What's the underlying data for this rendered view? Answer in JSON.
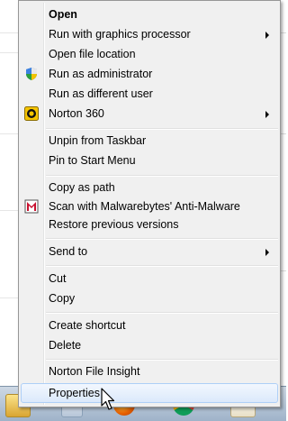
{
  "menu": {
    "items": [
      {
        "label": "Open",
        "bold": true
      },
      {
        "label": "Run with graphics processor",
        "submenu": true
      },
      {
        "label": "Open file location"
      },
      {
        "label": "Run as administrator",
        "icon": "uac-shield-icon"
      },
      {
        "label": "Run as different user"
      },
      {
        "label": "Norton 360",
        "icon": "norton-icon",
        "submenu": true
      },
      {
        "label": "Unpin from Taskbar"
      },
      {
        "label": "Pin to Start Menu"
      },
      {
        "label": "Copy as path"
      },
      {
        "label": "Scan with Malwarebytes' Anti-Malware",
        "icon": "malwarebytes-icon"
      },
      {
        "label": "Restore previous versions"
      },
      {
        "label": "Send to",
        "submenu": true
      },
      {
        "label": "Cut"
      },
      {
        "label": "Copy"
      },
      {
        "label": "Create shortcut"
      },
      {
        "label": "Delete"
      },
      {
        "label": "Norton File Insight"
      },
      {
        "label": "Properties",
        "highlighted": true
      }
    ]
  },
  "colors": {
    "menu_bg": "#f0f0f0",
    "highlight_border": "#aecff7",
    "norton_yellow": "#f5c400",
    "malwarebytes_red": "#c8102e"
  }
}
